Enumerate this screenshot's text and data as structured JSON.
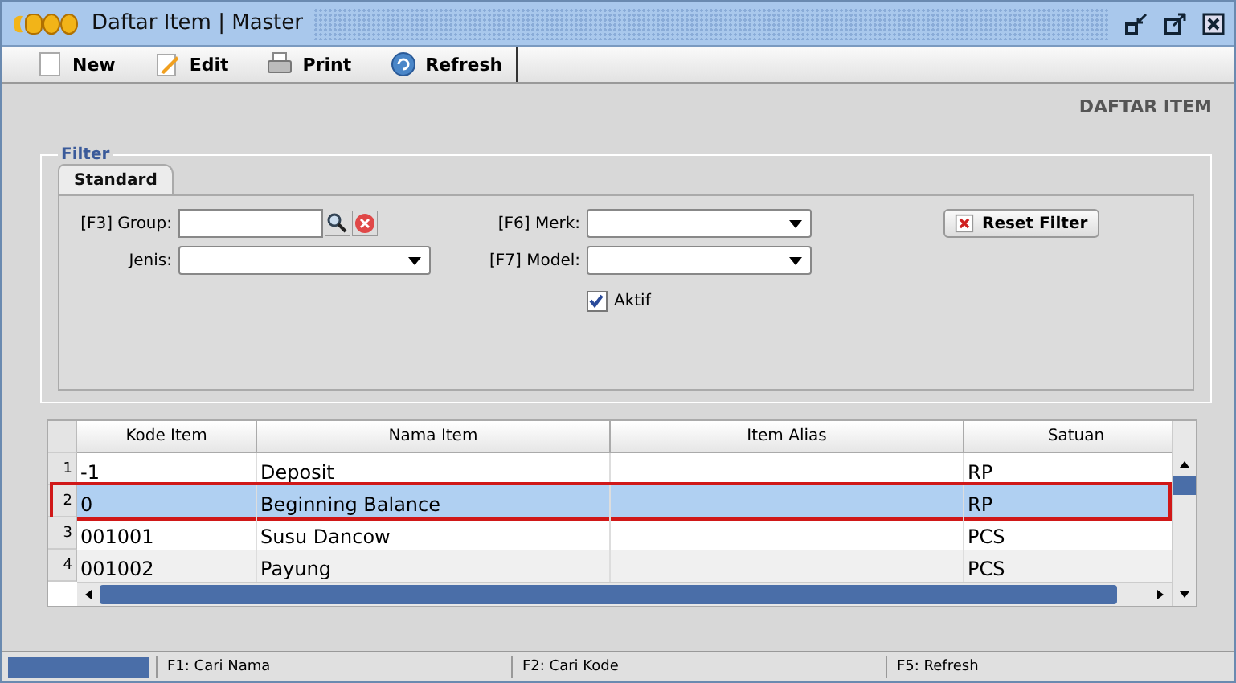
{
  "window": {
    "title": "Daftar Item | Master"
  },
  "toolbar": [
    {
      "kind": "new",
      "label": "New"
    },
    {
      "kind": "edit",
      "label": "Edit"
    },
    {
      "kind": "print",
      "label": "Print"
    },
    {
      "kind": "refresh",
      "label": "Refresh"
    }
  ],
  "page_heading": "DAFTAR ITEM",
  "filter": {
    "legend": "Filter",
    "tabs": [
      {
        "label": "Standard",
        "selected": true
      }
    ],
    "group_label": "[F3] Group:",
    "jenis_label": "Jenis:",
    "merk_label": "[F6] Merk:",
    "model_label": "[F7] Model:",
    "aktif": {
      "label": "Aktif",
      "checked": true
    },
    "reset_button": "Reset Filter"
  },
  "table": {
    "columns": [
      "Kode Item",
      "Nama Item",
      "Item Alias",
      "Satuan"
    ],
    "rows": [
      {
        "number": "1",
        "cells": [
          "-1",
          "Deposit",
          "",
          "RP"
        ],
        "selected": false,
        "outlined": false
      },
      {
        "number": "2",
        "cells": [
          "0",
          "Beginning Balance",
          "",
          "RP"
        ],
        "selected": true,
        "outlined": true
      },
      {
        "number": "3",
        "cells": [
          "001001",
          "Susu Dancow",
          "",
          "PCS"
        ],
        "selected": false,
        "outlined": false
      },
      {
        "number": "4",
        "cells": [
          "001002",
          "Payung",
          "",
          "PCS"
        ],
        "selected": false,
        "outlined": false
      }
    ]
  },
  "status_bar": [
    "F1: Cari Nama",
    "F2: Cari Kode",
    "F5: Refresh"
  ]
}
